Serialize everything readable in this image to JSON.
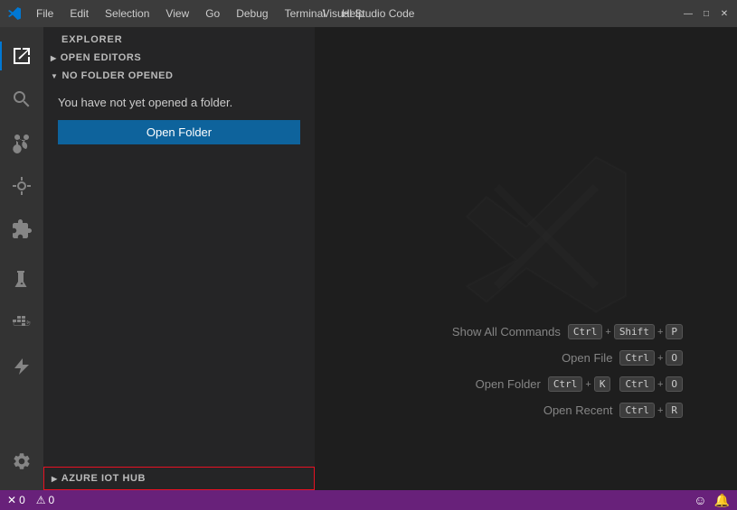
{
  "titleBar": {
    "logo": "VS",
    "menuItems": [
      "File",
      "Edit",
      "Selection",
      "View",
      "Go",
      "Debug",
      "Terminal",
      "Help"
    ],
    "title": "Visual Studio Code",
    "windowControls": [
      "—",
      "□",
      "✕"
    ]
  },
  "activityBar": {
    "icons": [
      {
        "name": "explorer-icon",
        "symbol": "⎘",
        "active": true
      },
      {
        "name": "search-icon",
        "symbol": "🔍",
        "active": false
      },
      {
        "name": "source-control-icon",
        "symbol": "⑂",
        "active": false
      },
      {
        "name": "debug-icon",
        "symbol": "⊘",
        "active": false
      },
      {
        "name": "extensions-icon",
        "symbol": "⊞",
        "active": false
      },
      {
        "name": "flask-icon",
        "symbol": "⚗",
        "active": false
      },
      {
        "name": "docker-icon",
        "symbol": "🐋",
        "active": false
      },
      {
        "name": "azure-icon",
        "symbol": "▲",
        "active": false
      }
    ],
    "bottomIcon": {
      "name": "settings-icon",
      "symbol": "⚙"
    }
  },
  "sidebar": {
    "header": "EXPLORER",
    "sections": [
      {
        "label": "OPEN EDITORS",
        "collapsed": true
      },
      {
        "label": "NO FOLDER OPENED",
        "collapsed": false
      }
    ],
    "noFolderText": "You have not yet opened a folder.",
    "openFolderButton": "Open Folder"
  },
  "azureIotHub": {
    "label": "AZURE IOT HUB"
  },
  "shortcuts": [
    {
      "label": "Show All Commands",
      "keys": [
        [
          "Ctrl"
        ],
        [
          "+"
        ],
        [
          "Shift"
        ],
        [
          "+"
        ],
        [
          "P"
        ]
      ]
    },
    {
      "label": "Open File",
      "keys": [
        [
          "Ctrl"
        ],
        [
          "+"
        ],
        [
          "O"
        ]
      ]
    },
    {
      "label": "Open Folder",
      "keys": [
        [
          "Ctrl"
        ],
        [
          "+"
        ],
        [
          "K"
        ],
        [
          "Ctrl"
        ],
        [
          "+"
        ],
        [
          "O"
        ]
      ]
    },
    {
      "label": "Open Recent",
      "keys": [
        [
          "Ctrl"
        ],
        [
          "+"
        ],
        [
          "R"
        ]
      ]
    }
  ],
  "statusBar": {
    "left": [
      {
        "icon": "✕",
        "count": "0"
      },
      {
        "icon": "⚠",
        "count": "0"
      }
    ],
    "right": [
      {
        "name": "smiley-icon",
        "symbol": "☺"
      },
      {
        "name": "bell-icon",
        "symbol": "🔔"
      }
    ]
  }
}
